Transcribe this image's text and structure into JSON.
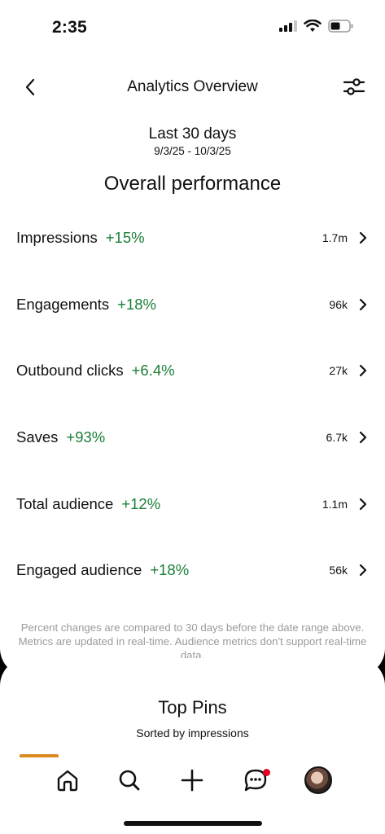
{
  "status_bar": {
    "time": "2:35"
  },
  "header": {
    "title": "Analytics Overview",
    "back_icon": "chevron-left-icon",
    "filter_icon": "sliders-icon"
  },
  "date_range": {
    "label": "Last 30 days",
    "dates": "9/3/25 - 10/3/25"
  },
  "overall": {
    "title": "Overall performance",
    "metrics": [
      {
        "name": "Impressions",
        "change": "+15%",
        "value": "1.7m"
      },
      {
        "name": "Engagements",
        "change": "+18%",
        "value": "96k"
      },
      {
        "name": "Outbound clicks",
        "change": "+6.4%",
        "value": "27k"
      },
      {
        "name": "Saves",
        "change": "+93%",
        "value": "6.7k"
      },
      {
        "name": "Total audience",
        "change": "+12%",
        "value": "1.1m"
      },
      {
        "name": "Engaged audience",
        "change": "+18%",
        "value": "56k"
      }
    ],
    "footnote": "Percent changes are compared to 30 days before the date range above. Metrics are updated in real-time. Audience metrics don't support real-time data."
  },
  "top_pins": {
    "title": "Top Pins",
    "subtitle": "Sorted by impressions"
  },
  "bottom_nav": {
    "items": [
      "home-icon",
      "search-icon",
      "plus-icon",
      "messages-icon",
      "avatar"
    ],
    "notification_color": "#e60023"
  },
  "colors": {
    "positive": "#1a7f37",
    "muted": "#9a9a9a",
    "accent": "#e60023"
  }
}
